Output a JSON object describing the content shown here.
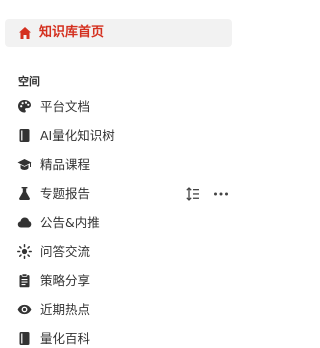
{
  "home": {
    "label": "知识库首页",
    "icon": "home-icon",
    "accent_color": "#d4301f"
  },
  "section": {
    "title": "空间"
  },
  "nav_items": [
    {
      "label": "平台文档",
      "icon": "palette-icon"
    },
    {
      "label": "AI量化知识树",
      "icon": "book-icon"
    },
    {
      "label": "精品课程",
      "icon": "graduation-cap-icon"
    },
    {
      "label": "专题报告",
      "icon": "flask-icon",
      "actions": [
        "sort-icon",
        "more-icon"
      ]
    },
    {
      "label": "公告&内推",
      "icon": "cloud-icon"
    },
    {
      "label": "问答交流",
      "icon": "sun-icon"
    },
    {
      "label": "策略分享",
      "icon": "clipboard-icon"
    },
    {
      "label": "近期热点",
      "icon": "eye-icon"
    },
    {
      "label": "量化百科",
      "icon": "book-icon"
    }
  ]
}
